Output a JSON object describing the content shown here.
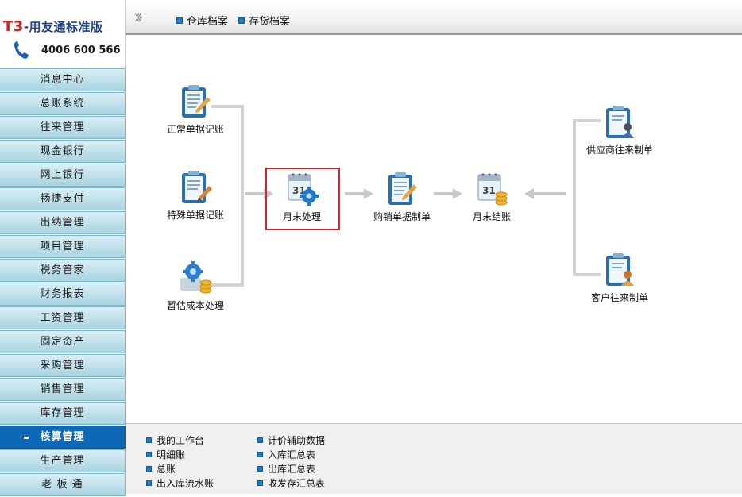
{
  "brand": {
    "prefix": "T3",
    "title": "-用友通标准版",
    "phone": "4006 600 566"
  },
  "sidebar": {
    "items": [
      {
        "label": "消息中心"
      },
      {
        "label": "总账系统"
      },
      {
        "label": "往来管理"
      },
      {
        "label": "现金银行"
      },
      {
        "label": "网上银行"
      },
      {
        "label": "畅捷支付"
      },
      {
        "label": "出纳管理"
      },
      {
        "label": "项目管理"
      },
      {
        "label": "税务管家"
      },
      {
        "label": "财务报表"
      },
      {
        "label": "工资管理"
      },
      {
        "label": "固定资产"
      },
      {
        "label": "采购管理"
      },
      {
        "label": "销售管理"
      },
      {
        "label": "库存管理"
      },
      {
        "label": "核算管理",
        "active": true
      },
      {
        "label": "生产管理"
      },
      {
        "label": "老 板 通"
      }
    ]
  },
  "topbar": {
    "collapse_glyph": "》》",
    "links": [
      "仓库档案",
      "存货档案"
    ]
  },
  "flow": {
    "normal_voucher": "正常单据记账",
    "special_voucher": "特殊单据记账",
    "estimated_cost": "暂估成本处理",
    "month_end": "月末处理",
    "purchase_sales": "购销单据制单",
    "month_close": "月末结账",
    "supplier": "供应商往来制单",
    "customer": "客户往来制单"
  },
  "bottom": {
    "col1": [
      "我的工作台",
      "明细账",
      "总账",
      "出入库流水账"
    ],
    "col2": [
      "计价辅助数据",
      "入库汇总表",
      "出库汇总表",
      "收发存汇总表"
    ]
  },
  "colors": {
    "accent": "#0d68b8",
    "highlight": "#e02020",
    "brand_red": "#d5201e",
    "brand_blue": "#1f3f86"
  }
}
